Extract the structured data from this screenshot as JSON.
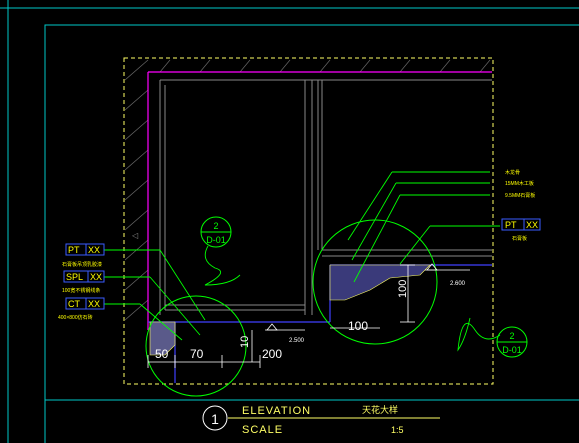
{
  "colors": {
    "background": "#000000",
    "frame": "#00c8c8",
    "leader": "#00ff00",
    "tag": "#ffff00",
    "tag_box": "#3a5cff",
    "magenta": "#ff00ff",
    "wall": "#808080",
    "hatch": "#5a3a3a",
    "outline": "#ffff66",
    "blue_line": "#4040ff"
  },
  "left_tags": [
    {
      "code": "PT",
      "sub": "XX",
      "note": "石膏板吊顶乳胶漆"
    },
    {
      "code": "SPL",
      "sub": "XX",
      "note": "100宽不锈钢线条"
    },
    {
      "code": "CT",
      "sub": "XX",
      "note": "400×800仿石砖"
    }
  ],
  "right_tag": {
    "code": "PT",
    "sub": "XX",
    "note": "石膏板"
  },
  "right_leaders": [
    "木龙骨",
    "15MM木工板",
    "9.5MM石膏板"
  ],
  "section_refs": [
    {
      "num": "2",
      "sheet": "D-01"
    },
    {
      "num": "2",
      "sheet": "D-01"
    }
  ],
  "dimensions": {
    "d50": "50",
    "d70": "70",
    "d10": "10",
    "d200": "200",
    "d100h": "100",
    "d100v": "100",
    "level_left": "2.500",
    "level_right": "2.600"
  },
  "title_block": {
    "number": "1",
    "elevation_label": "ELEVATION",
    "elevation_value": "天花大样",
    "scale_label": "SCALE",
    "scale_value": "1:5"
  }
}
